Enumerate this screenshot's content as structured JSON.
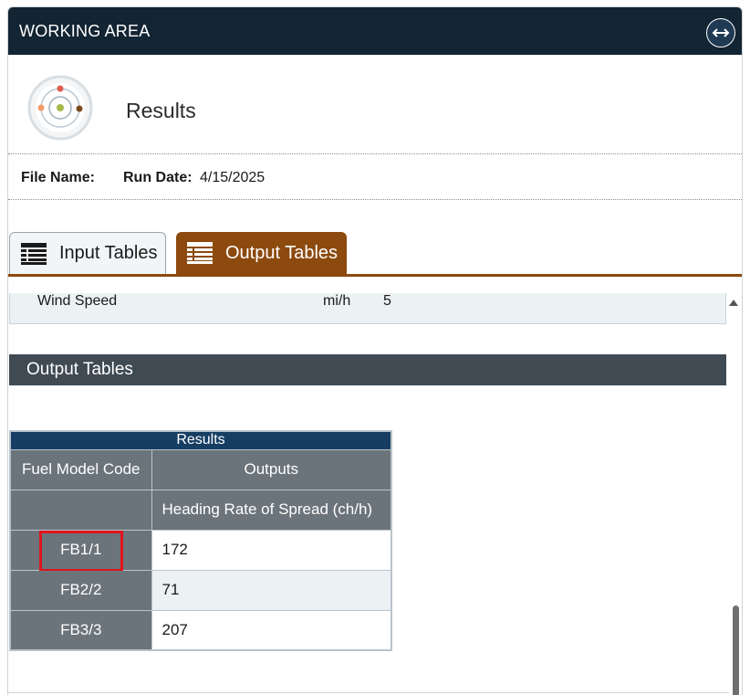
{
  "panel": {
    "title": "WORKING AREA",
    "expand_icon": "arrows-horizontal-icon"
  },
  "header": {
    "logo_icon": "target-orbit-logo",
    "title": "Results"
  },
  "file_info": {
    "file_name_label": "File Name:",
    "file_name_value": "",
    "run_date_label": "Run Date:",
    "run_date_value": "4/15/2025"
  },
  "tabs": [
    {
      "label": "Input Tables",
      "icon": "table-icon",
      "active": false
    },
    {
      "label": "Output Tables",
      "icon": "table-icon",
      "active": true
    }
  ],
  "input_row": {
    "label": "Wind Speed",
    "unit": "mi/h",
    "value": "5"
  },
  "section": {
    "title": "Output Tables"
  },
  "results_table": {
    "title": "Results",
    "col_code_header": "Fuel Model Code",
    "col_outputs_header": "Outputs",
    "sub_header": "Heading Rate of Spread (ch/h)",
    "rows": [
      {
        "code": "FB1/1",
        "value": "172"
      },
      {
        "code": "FB2/2",
        "value": "71"
      },
      {
        "code": "FB3/3",
        "value": "207"
      }
    ]
  },
  "colors": {
    "header_bg": "#132433",
    "tab_active": "#8c4a0f",
    "section_bar": "#3f4a53",
    "table_title": "#163e63",
    "table_header": "#6b747b",
    "highlight": "#e0141e"
  }
}
